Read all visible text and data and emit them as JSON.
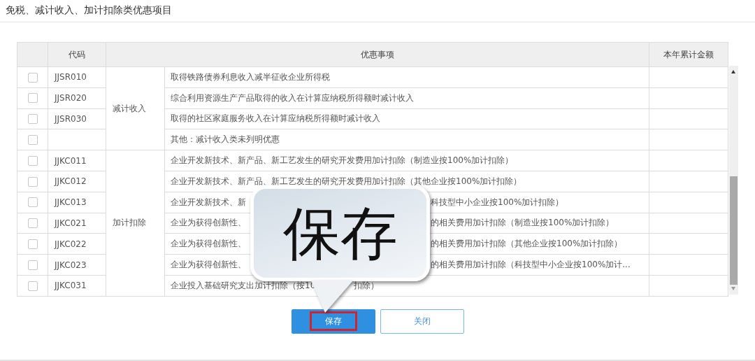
{
  "title": "免税、减计收入、加计扣除类优惠项目",
  "table": {
    "columns": {
      "code": "代码",
      "item": "优惠事项",
      "amount": "本年累计金额"
    },
    "groups": [
      {
        "label": "减计收入",
        "rows": [
          {
            "code": "JJSR010",
            "checked": false,
            "kind": "full",
            "text": "取得铁路债券利息收入减半征收企业所得税"
          },
          {
            "code": "JJSR020",
            "checked": false,
            "kind": "full",
            "text": "综合利用资源生产产品取得的收入在计算应纳税所得额时减计收入"
          },
          {
            "code": "JJSR030",
            "checked": false,
            "kind": "full",
            "text": "取得的社区家庭服务收入在计算应纳税所得额时减计收入"
          },
          {
            "checked": false,
            "kind": "full",
            "text": "其他：减计收入类未列明优惠"
          }
        ]
      },
      {
        "label": "加计扣除",
        "rows": [
          {
            "code": "JJKC011",
            "checked": false,
            "kind": "full",
            "text": "企业开发新技术、新产品、新工艺发生的研究开发费用加计扣除（制造业按100%加计扣除）"
          },
          {
            "code": "JJKC012",
            "checked": false,
            "kind": "full",
            "text": "企业开发新技术、新产品、新工艺发生的研究开发费用加计扣除（其他企业按100%加计扣除）"
          },
          {
            "code": "JJKC013",
            "checked": false,
            "kind": "split",
            "text": "企业开发新技术、新",
            "text_end": "科技型中小企业按100%加计扣除）"
          },
          {
            "code": "JJKC021",
            "checked": false,
            "kind": "split",
            "text": "企业为获得创新性、",
            "text_end": "的相关费用加计扣除（制造业按100%加计扣除）"
          },
          {
            "code": "JJKC022",
            "checked": false,
            "kind": "split",
            "text": "企业为获得创新性、",
            "text_end": "的相关费用加计扣除（其他企业按100%加计扣除）"
          },
          {
            "code": "JJKC023",
            "checked": false,
            "kind": "split",
            "text": "企业为获得创新性、",
            "text_end": "的相关费用加计扣除（科技型中小企业按100%加计..."
          },
          {
            "code": "JJKC031",
            "checked": false,
            "kind": "tailsplit",
            "text": "企业投入基础研究支出加计扣除（按10",
            "text_end": "扣除）"
          }
        ]
      }
    ]
  },
  "callout": {
    "text": "保存"
  },
  "buttons": [
    {
      "label": "保存",
      "kind": "primary",
      "highlighted": true
    },
    {
      "label": "关闭",
      "kind": "secondary",
      "highlighted": false
    }
  ]
}
